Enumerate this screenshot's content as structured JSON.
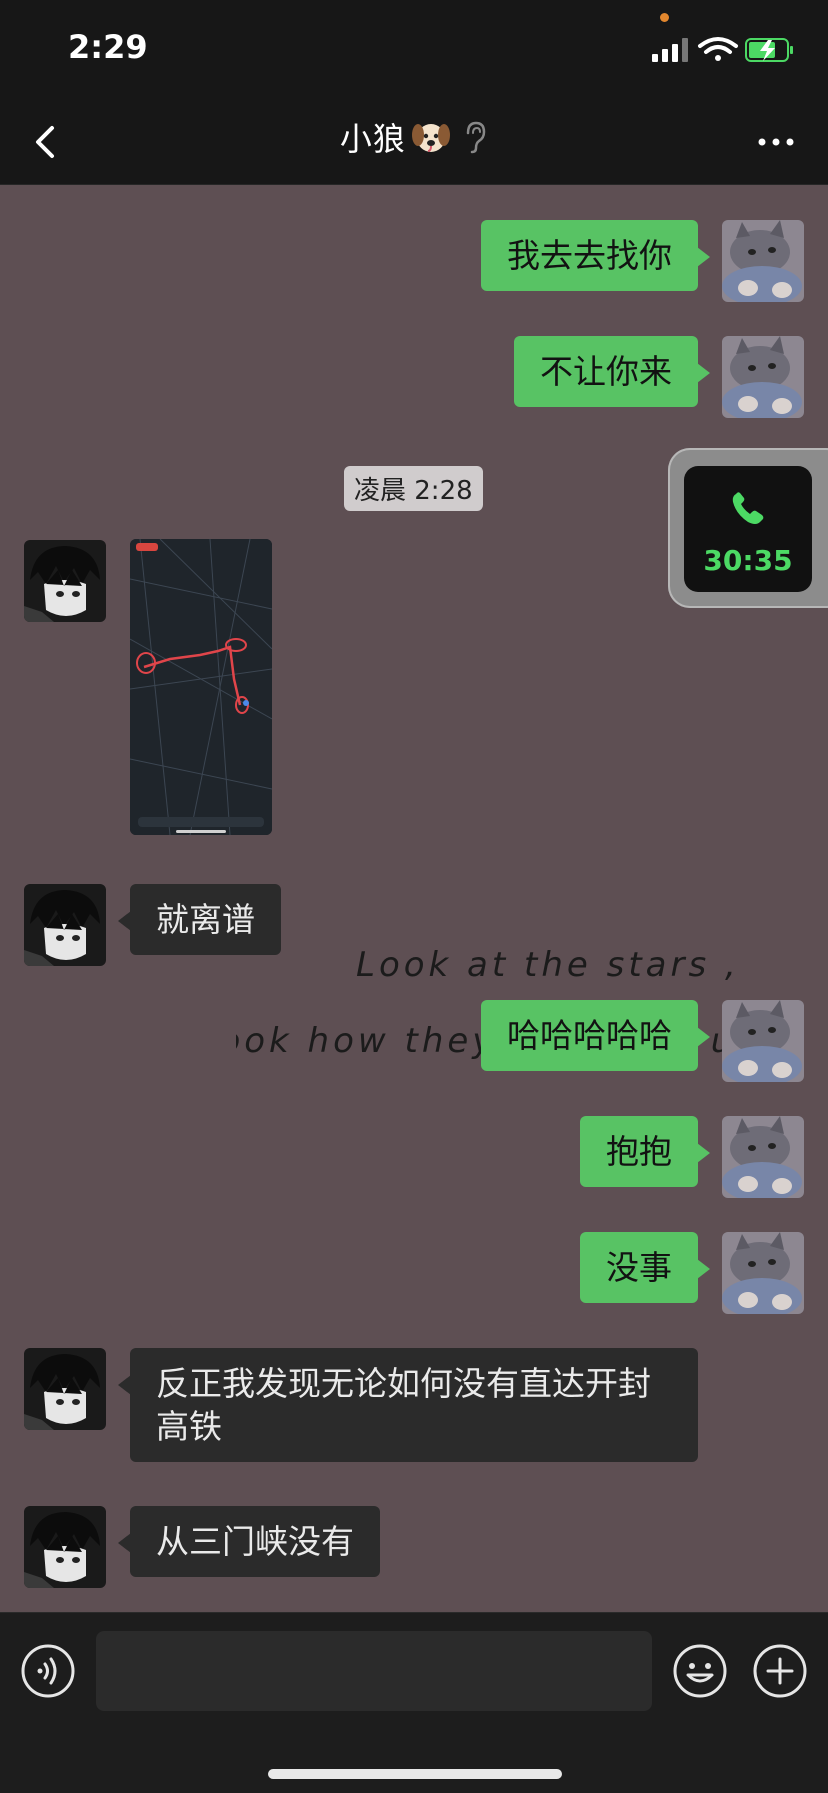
{
  "status": {
    "time": "2:29"
  },
  "header": {
    "title": "小狼",
    "title_emoji": "dog-face-icon",
    "ear_icon": "ear-icon",
    "more_icon": "more-icon",
    "back_icon": "back-chevron-icon"
  },
  "call": {
    "duration": "30:35"
  },
  "chat": {
    "timestamp": "凌晨 2:28",
    "messages": [
      {
        "from": "me",
        "text": "我去去找你"
      },
      {
        "from": "me",
        "text": "不让你来"
      },
      {
        "from": "other",
        "type": "image",
        "text": ""
      },
      {
        "from": "other",
        "text": "就离谱"
      },
      {
        "from": "me",
        "text": "哈哈哈哈哈"
      },
      {
        "from": "me",
        "text": "抱抱"
      },
      {
        "from": "me",
        "text": "没事"
      },
      {
        "from": "other",
        "text": "反正我发现无论如何没有直达开封高铁"
      },
      {
        "from": "other",
        "text": "从三门峡没有"
      }
    ]
  },
  "background_text": {
    "line1": "Look at the stars ,",
    "line2": "look how they shine for u ."
  },
  "input": {
    "placeholder": "",
    "value": ""
  },
  "colors": {
    "my_bubble": "#58c364",
    "other_bubble": "#2b2b2b",
    "background": "#5e4f53",
    "call_green": "#4cd964"
  }
}
